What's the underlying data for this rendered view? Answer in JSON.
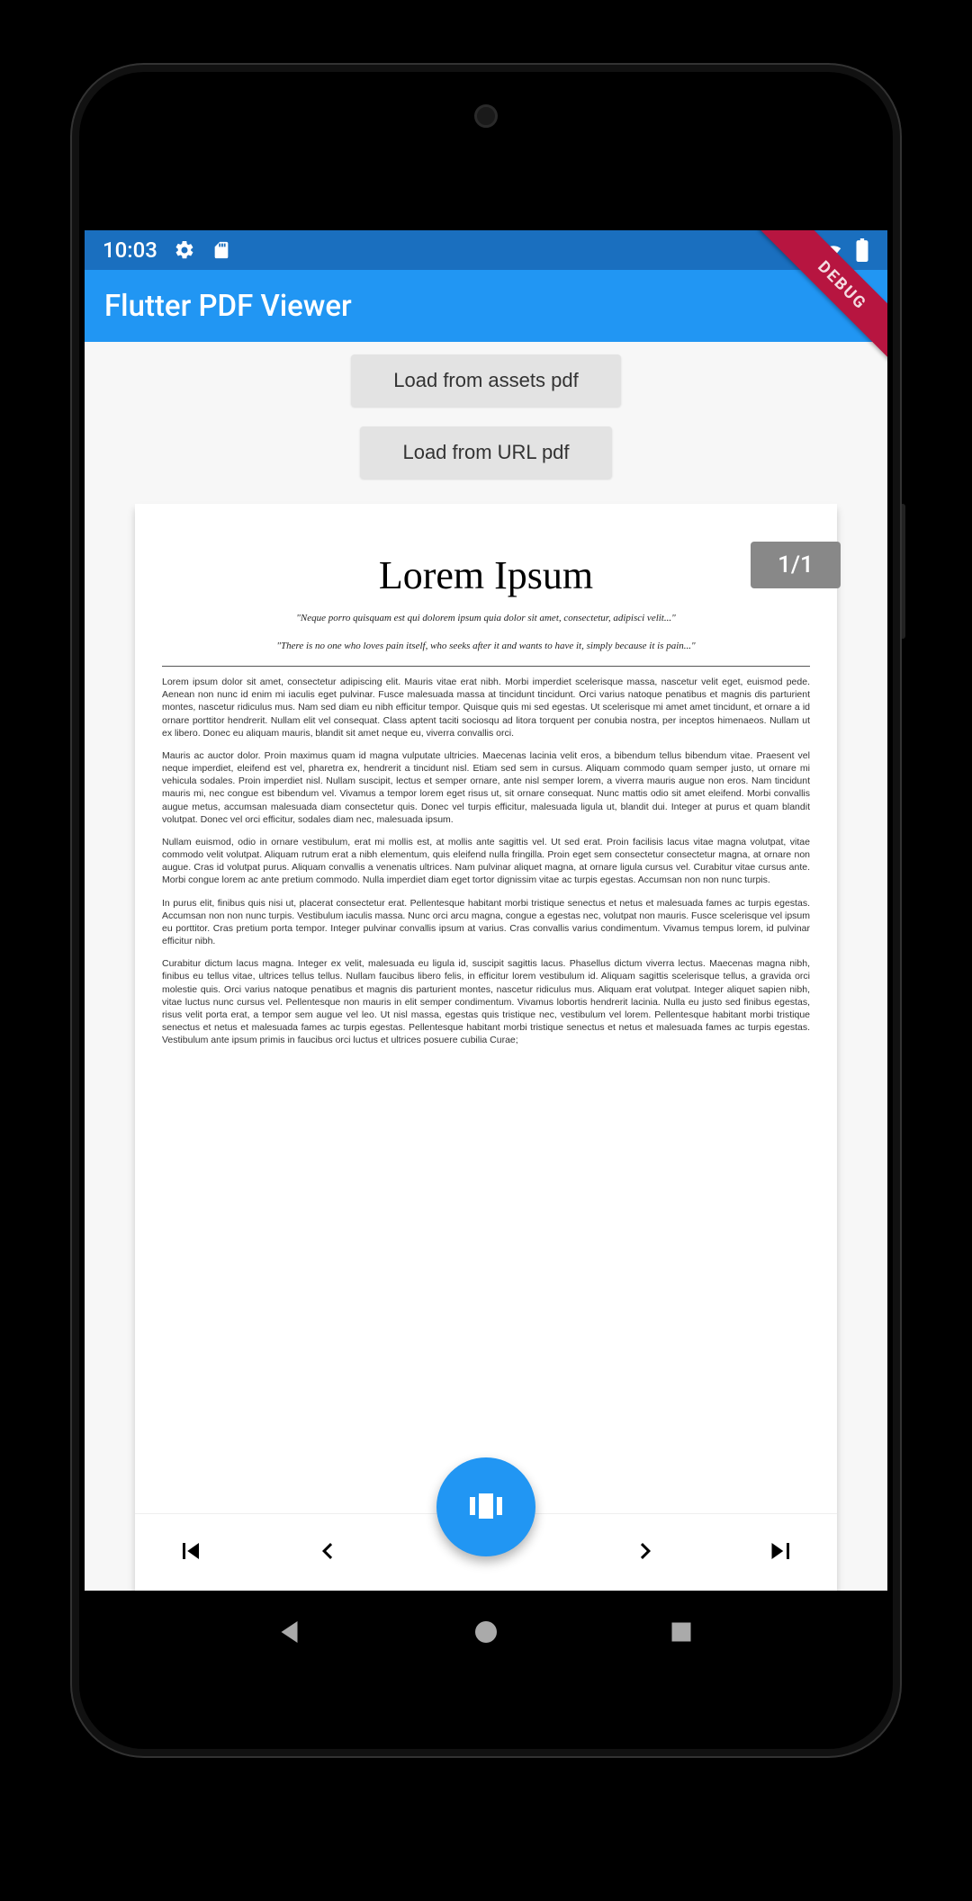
{
  "status": {
    "time": "10:03"
  },
  "appbar": {
    "title": "Flutter PDF Viewer"
  },
  "debug": {
    "label": "DEBUG"
  },
  "buttons": {
    "load_assets": "Load from assets pdf",
    "load_url": "Load from URL pdf"
  },
  "viewer": {
    "page_indicator": "1/1",
    "title": "Lorem Ipsum",
    "quote1": "\"Neque porro quisquam est qui dolorem ipsum quia dolor sit amet, consectetur, adipisci velit...\"",
    "quote2": "\"There is no one who loves pain itself, who seeks after it and wants to have it, simply because it is pain...\"",
    "paragraphs": [
      "Lorem ipsum dolor sit amet, consectetur adipiscing elit. Mauris vitae erat nibh. Morbi imperdiet scelerisque massa, nascetur velit eget, euismod pede. Aenean non nunc id enim mi iaculis eget pulvinar. Fusce malesuada massa at tincidunt tincidunt. Orci varius natoque penatibus et magnis dis parturient montes, nascetur ridiculus mus. Nam sed diam eu nibh efficitur tempor. Quisque quis mi sed egestas. Ut scelerisque mi amet amet tincidunt, et ornare a id ornare porttitor hendrerit. Nullam elit vel consequat. Class aptent taciti sociosqu ad litora torquent per conubia nostra, per inceptos himenaeos. Nullam ut ex libero. Donec eu aliquam mauris, blandit sit amet neque eu, viverra convallis orci.",
      "Mauris ac auctor dolor. Proin maximus quam id magna vulputate ultricies. Maecenas lacinia velit eros, a bibendum tellus bibendum vitae. Praesent vel neque imperdiet, eleifend est vel, pharetra ex, hendrerit a tincidunt nisl. Etiam sed sem in cursus. Aliquam commodo quam semper justo, ut ornare mi vehicula sodales. Proin imperdiet nisl. Nullam suscipit, lectus et semper ornare, ante nisl semper lorem, a viverra mauris augue non eros. Nam tincidunt mauris mi, nec congue est bibendum vel. Vivamus a tempor lorem eget risus ut, sit ornare consequat. Nunc mattis odio sit amet eleifend. Morbi convallis augue metus, accumsan malesuada diam consectetur quis. Donec vel turpis efficitur, malesuada ligula ut, blandit dui. Integer at purus et quam blandit volutpat. Donec vel orci efficitur, sodales diam nec, malesuada ipsum.",
      "Nullam euismod, odio in ornare vestibulum, erat mi mollis est, at mollis ante sagittis vel. Ut sed erat. Proin facilisis lacus vitae magna volutpat, vitae commodo velit volutpat. Aliquam rutrum erat a nibh elementum, quis eleifend nulla fringilla. Proin eget sem consectetur consectetur magna, at ornare non augue. Cras id volutpat purus. Aliquam convallis a venenatis ultrices. Nam pulvinar aliquet magna, at ornare ligula cursus vel. Curabitur vitae cursus ante. Morbi congue lorem ac ante pretium commodo. Nulla imperdiet diam eget tortor dignissim vitae ac turpis egestas. Accumsan non non nunc turpis.",
      "In purus elit, finibus quis nisi ut, placerat consectetur erat. Pellentesque habitant morbi tristique senectus et netus et malesuada fames ac turpis egestas. Accumsan non non nunc turpis. Vestibulum iaculis massa. Nunc orci arcu magna, congue a egestas nec, volutpat non mauris. Fusce scelerisque vel ipsum eu porttitor. Cras pretium porta tempor. Integer pulvinar convallis ipsum at varius. Cras convallis varius condimentum. Vivamus tempus lorem, id pulvinar efficitur nibh.",
      "Curabitur dictum lacus magna. Integer ex velit, malesuada eu ligula id, suscipit sagittis lacus. Phasellus dictum viverra lectus. Maecenas magna nibh, finibus eu tellus vitae, ultrices tellus tellus. Nullam faucibus libero felis, in efficitur lorem vestibulum id. Aliquam sagittis scelerisque tellus, a gravida orci molestie quis. Orci varius natoque penatibus et magnis dis parturient montes, nascetur ridiculus mus. Aliquam erat volutpat. Integer aliquet sapien nibh, vitae luctus nunc cursus vel. Pellentesque non mauris in elit semper condimentum. Vivamus lobortis hendrerit lacinia. Nulla eu justo sed finibus egestas, risus velit porta erat, a tempor sem augue vel leo. Ut nisl massa, egestas quis tristique nec, vestibulum vel lorem. Pellentesque habitant morbi tristique senectus et netus et malesuada fames ac turpis egestas. Pellentesque habitant morbi tristique senectus et netus et malesuada fames ac turpis egestas. Vestibulum ante ipsum primis in faucibus orci luctus et ultrices posuere cubilia Curae;"
    ]
  }
}
